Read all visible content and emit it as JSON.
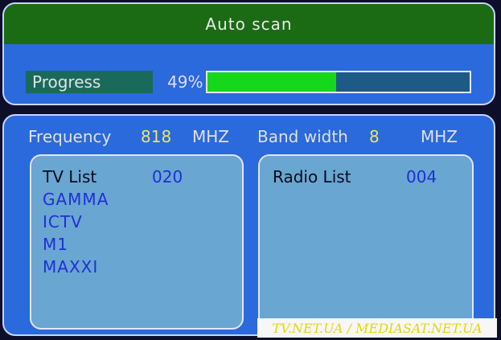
{
  "header": {
    "title": "Auto scan"
  },
  "progress": {
    "label": "Progress",
    "percent_text": "49%",
    "percent": 49
  },
  "frequency": {
    "label": "Frequency",
    "value": "818",
    "unit": "MHZ"
  },
  "bandwidth": {
    "label": "Band width",
    "value": "8",
    "unit": "MHZ"
  },
  "tv_list": {
    "label": "TV List",
    "count": "020",
    "channels": [
      "GAMMA",
      "ICTV",
      "M1",
      "MAXXI"
    ]
  },
  "radio_list": {
    "label": "Radio List",
    "count": "004"
  },
  "watermark": "TV.NET.UA / MEDIASAT.NET.UA",
  "colors": {
    "panel_bg": "#2a6adc",
    "title_bg": "#1a6b14",
    "progress_fill": "#16d81a",
    "list_bg": "#69a6d2",
    "channel_text": "#1f2fd8"
  }
}
